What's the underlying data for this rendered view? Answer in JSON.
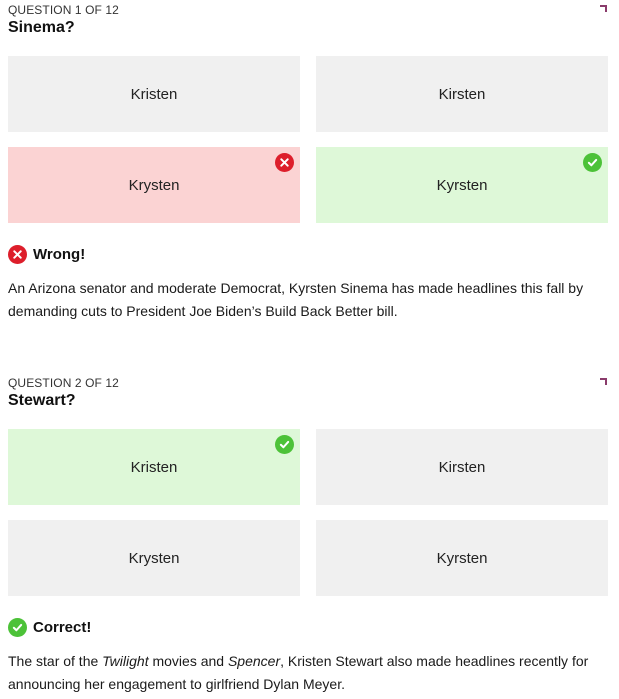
{
  "questions": [
    {
      "counter": "QUESTION 1 OF 12",
      "title": "Sinema?",
      "answers": [
        {
          "label": "Kristen",
          "state": "neutral"
        },
        {
          "label": "Kirsten",
          "state": "neutral"
        },
        {
          "label": "Krysten",
          "state": "wrong-selected"
        },
        {
          "label": "Kyrsten",
          "state": "correct"
        }
      ],
      "result": "Wrong!",
      "explanation_parts": [
        "An Arizona senator and moderate Democrat, Kyrsten Sinema has made headlines this fall by demanding cuts to President Joe Biden’s Build Back Better bill."
      ]
    },
    {
      "counter": "QUESTION 2 OF 12",
      "title": "Stewart?",
      "answers": [
        {
          "label": "Kristen",
          "state": "correct-selected"
        },
        {
          "label": "Kirsten",
          "state": "neutral"
        },
        {
          "label": "Krysten",
          "state": "neutral"
        },
        {
          "label": "Kyrsten",
          "state": "neutral"
        }
      ],
      "result": "Correct!",
      "explanation_parts": [
        "The star of the ",
        "Twilight",
        " movies and ",
        "Spencer",
        ", Kristen Stewart also made headlines recently for announcing her engagement to girlfriend Dylan Meyer."
      ]
    }
  ],
  "colors": {
    "wrong_bg": "#fbd3d3",
    "correct_bg": "#def8d8",
    "neutral_bg": "#f0f0f0",
    "wrong_icon": "#dd1e2b",
    "correct_icon": "#4cc238",
    "corner_accent": "#8a3b6b"
  },
  "icons": {
    "wrong": "x-circle-icon",
    "correct": "check-circle-icon"
  }
}
